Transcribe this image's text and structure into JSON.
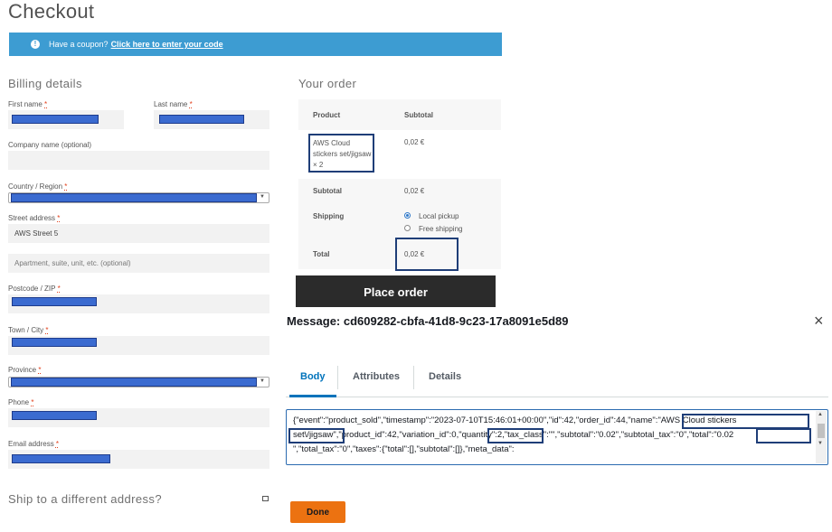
{
  "checkout": {
    "title": "Checkout",
    "coupon": {
      "text": "Have a coupon?",
      "link": "Click here to enter your code"
    },
    "billing": {
      "title": "Billing details",
      "required_marker": "*",
      "first_name_label": "First name",
      "last_name_label": "Last name",
      "company_label": "Company name (optional)",
      "country_label": "Country / Region",
      "street_label": "Street address",
      "street_value": "AWS Street 5",
      "apartment_placeholder": "Apartment, suite, unit, etc. (optional)",
      "postcode_label": "Postcode / ZIP",
      "city_label": "Town / City",
      "province_label": "Province",
      "phone_label": "Phone",
      "email_label": "Email address"
    },
    "ship_different": "Ship to a different address?",
    "order": {
      "title": "Your order",
      "col_product": "Product",
      "col_subtotal": "Subtotal",
      "item_name": "AWS Cloud stickers set/jigsaw",
      "item_qty": "× 2",
      "item_price": "0,02 €",
      "subtotal_label": "Subtotal",
      "subtotal_value": "0,02 €",
      "shipping_label": "Shipping",
      "shipping_options": [
        "Local pickup",
        "Free shipping"
      ],
      "total_label": "Total",
      "total_value": "0,02 €"
    },
    "place_order": "Place order"
  },
  "message": {
    "title": "Message: cd609282-cbfa-41d8-9c23-17a8091e5d89",
    "close": "×",
    "tabs": [
      "Body",
      "Attributes",
      "Details"
    ],
    "body_line1": "{\"event\":\"product_sold\",\"timestamp\":\"2023-07-10T15:46:01+00:00\",\"id\":42,\"order_id\":44,\"name\":\"AWS Cloud stickers",
    "body_line2": "set\\/jigsaw\",\"product_id\":42,\"variation_id\":0,\"quantity\":2,\"tax_class\":\"\",\"subtotal\":\"0.02\",\"subtotal_tax\":\"0\",\"total\":\"0.02",
    "body_line3": "\",\"total_tax\":\"0\",\"taxes\":{\"total\":[],\"subtotal\":[]},\"meta_data\":",
    "done": "Done"
  },
  "colors": {
    "coupon_bar": "#3d9cd2",
    "done_button": "#ec7211",
    "active_tab": "#0073bb",
    "redaction": "#3b6bd0"
  }
}
